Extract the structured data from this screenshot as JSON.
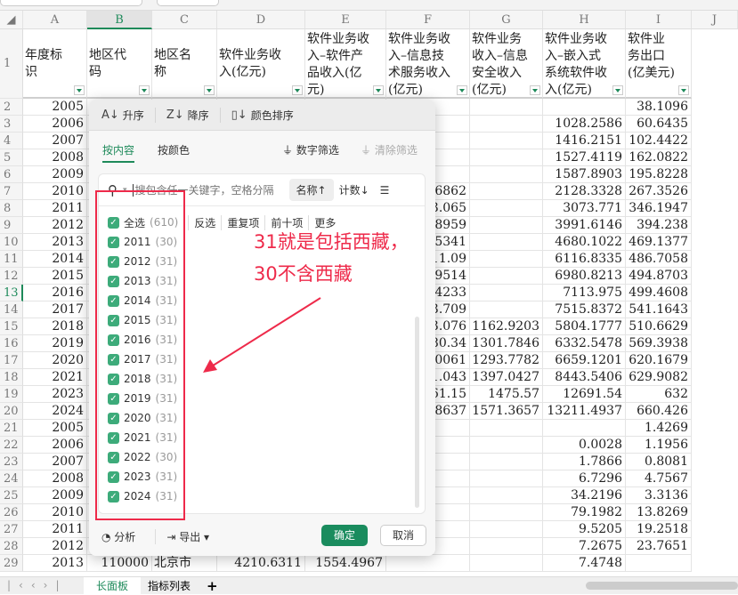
{
  "columns": [
    "A",
    "B",
    "C",
    "D",
    "E",
    "F",
    "G",
    "H",
    "I",
    "J"
  ],
  "headers": [
    "年度标识",
    "地区代码",
    "地区名称",
    "软件业务收入(亿元)",
    "软件业务收入–软件产品收入(亿元)",
    "软件业务收入–信息技术服务收入(亿元)",
    "软件业务收入–信息安全收入(亿元)",
    "软件业务收入–嵌入式系统软件收入(亿元)",
    "软件业务出口(亿美元)"
  ],
  "rows": [
    [
      "2",
      "2005",
      "",
      "",
      "",
      "",
      "",
      "",
      "",
      "38.1096"
    ],
    [
      "3",
      "2006",
      "",
      "",
      "",
      "",
      "",
      "",
      "1028.2586",
      "60.6435"
    ],
    [
      "4",
      "2007",
      "",
      "",
      "",
      "",
      "",
      "",
      "1416.2151",
      "102.4422"
    ],
    [
      "5",
      "2008",
      "",
      "",
      "",
      "",
      "",
      "",
      "1527.4119",
      "162.0822"
    ],
    [
      "6",
      "2009",
      "",
      "",
      "",
      "",
      "",
      "",
      "1587.8903",
      "195.8228"
    ],
    [
      "7",
      "2010",
      "",
      "",
      "",
      "",
      ".6862",
      "",
      "2128.3328",
      "267.3526"
    ],
    [
      "8",
      "2011",
      "",
      "",
      "",
      "",
      "3.065",
      "",
      "3073.771",
      "346.1947"
    ],
    [
      "9",
      "2012",
      "",
      "",
      "",
      "",
      ".8959",
      "",
      "3991.6146",
      "394.238"
    ],
    [
      "10",
      "2013",
      "",
      "",
      "",
      "",
      ".5341",
      "",
      "4680.1022",
      "469.1377"
    ],
    [
      "11",
      "2014",
      "",
      "",
      "",
      "",
      "11.09",
      "",
      "6116.8335",
      "486.7058"
    ],
    [
      "12",
      "2015",
      "",
      "",
      "",
      "",
      ".9514",
      "",
      "6980.8213",
      "494.8703"
    ],
    [
      "13",
      "2016",
      "",
      "",
      "",
      "",
      ".4233",
      "",
      "7113.975",
      "499.4608"
    ],
    [
      "14",
      "2017",
      "",
      "",
      "",
      "",
      "3.709",
      "",
      "7515.8372",
      "541.1643"
    ],
    [
      "15",
      "2018",
      "",
      "",
      "",
      "",
      "3.076",
      "1162.9203",
      "5804.1777",
      "510.6629"
    ],
    [
      "16",
      "2019",
      "",
      "",
      "",
      "",
      "80.34",
      "1301.7846",
      "6332.5478",
      "569.3938"
    ],
    [
      "17",
      "2020",
      "",
      "",
      "",
      "",
      ".0061",
      "1293.7782",
      "6659.1201",
      "620.1679"
    ],
    [
      "18",
      "2021",
      "",
      "",
      "",
      "",
      "1.043",
      "1397.0427",
      "8443.5406",
      "629.9082"
    ],
    [
      "19",
      "2023",
      "",
      "",
      "",
      "",
      "61.15",
      "1475.57",
      "12691.54",
      "632"
    ],
    [
      "20",
      "2024",
      "",
      "",
      "",
      "",
      ".8637",
      "1571.3657",
      "13211.4937",
      "660.426"
    ],
    [
      "21",
      "2005",
      "",
      "",
      "",
      "",
      "",
      "",
      "",
      "1.4269"
    ],
    [
      "22",
      "2006",
      "",
      "",
      "",
      "",
      "",
      "",
      "0.0028",
      "1.1956"
    ],
    [
      "23",
      "2007",
      "",
      "",
      "",
      "",
      "",
      "",
      "1.7866",
      "0.8081"
    ],
    [
      "24",
      "2008",
      "",
      "",
      "",
      "",
      "",
      "",
      "6.7296",
      "4.7567"
    ],
    [
      "25",
      "2009",
      "",
      "",
      "",
      "",
      "",
      "",
      "34.2196",
      "3.3136"
    ],
    [
      "26",
      "2010",
      "",
      "",
      "",
      "",
      "",
      "",
      "79.1982",
      "13.8269"
    ],
    [
      "27",
      "2011",
      "",
      "",
      "",
      "",
      "",
      "",
      "9.5205",
      "19.2518"
    ],
    [
      "28",
      "2012",
      "",
      "",
      "",
      "",
      "",
      "",
      "7.2675",
      "23.7651"
    ],
    [
      "29",
      "2013",
      "110000",
      "北京市",
      "4210.6311",
      "1554.4967",
      "",
      "",
      "7.4748",
      ""
    ]
  ],
  "filter": {
    "sort_asc": "升序",
    "sort_desc": "降序",
    "sort_color": "颜色排序",
    "tab_content": "按内容",
    "tab_color": "按颜色",
    "number_filter": "数字筛选",
    "clear_filter": "清除筛选",
    "search_placeholder": "搜包含任一关键字，空格分隔",
    "sort_name": "名称↑",
    "sort_count": "计数↓",
    "select_all": "全选",
    "select_all_count": "(610)",
    "actions": [
      "反选",
      "重复项",
      "前十项",
      "更多"
    ],
    "items": [
      [
        "2011",
        "(30)"
      ],
      [
        "2012",
        "(31)"
      ],
      [
        "2013",
        "(31)"
      ],
      [
        "2014",
        "(31)"
      ],
      [
        "2015",
        "(31)"
      ],
      [
        "2016",
        "(31)"
      ],
      [
        "2017",
        "(31)"
      ],
      [
        "2018",
        "(31)"
      ],
      [
        "2019",
        "(31)"
      ],
      [
        "2020",
        "(31)"
      ],
      [
        "2021",
        "(31)"
      ],
      [
        "2022",
        "(30)"
      ],
      [
        "2023",
        "(31)"
      ],
      [
        "2024",
        "(31)"
      ]
    ],
    "analyze": "分析",
    "export": "导出",
    "ok": "确定",
    "cancel": "取消"
  },
  "annotation": {
    "line1": "31就是包括西藏，",
    "line2": "30不含西藏",
    "color": "#ee2a4a"
  },
  "sheets": {
    "active": "长面板",
    "other": "指标列表",
    "add": "+"
  }
}
